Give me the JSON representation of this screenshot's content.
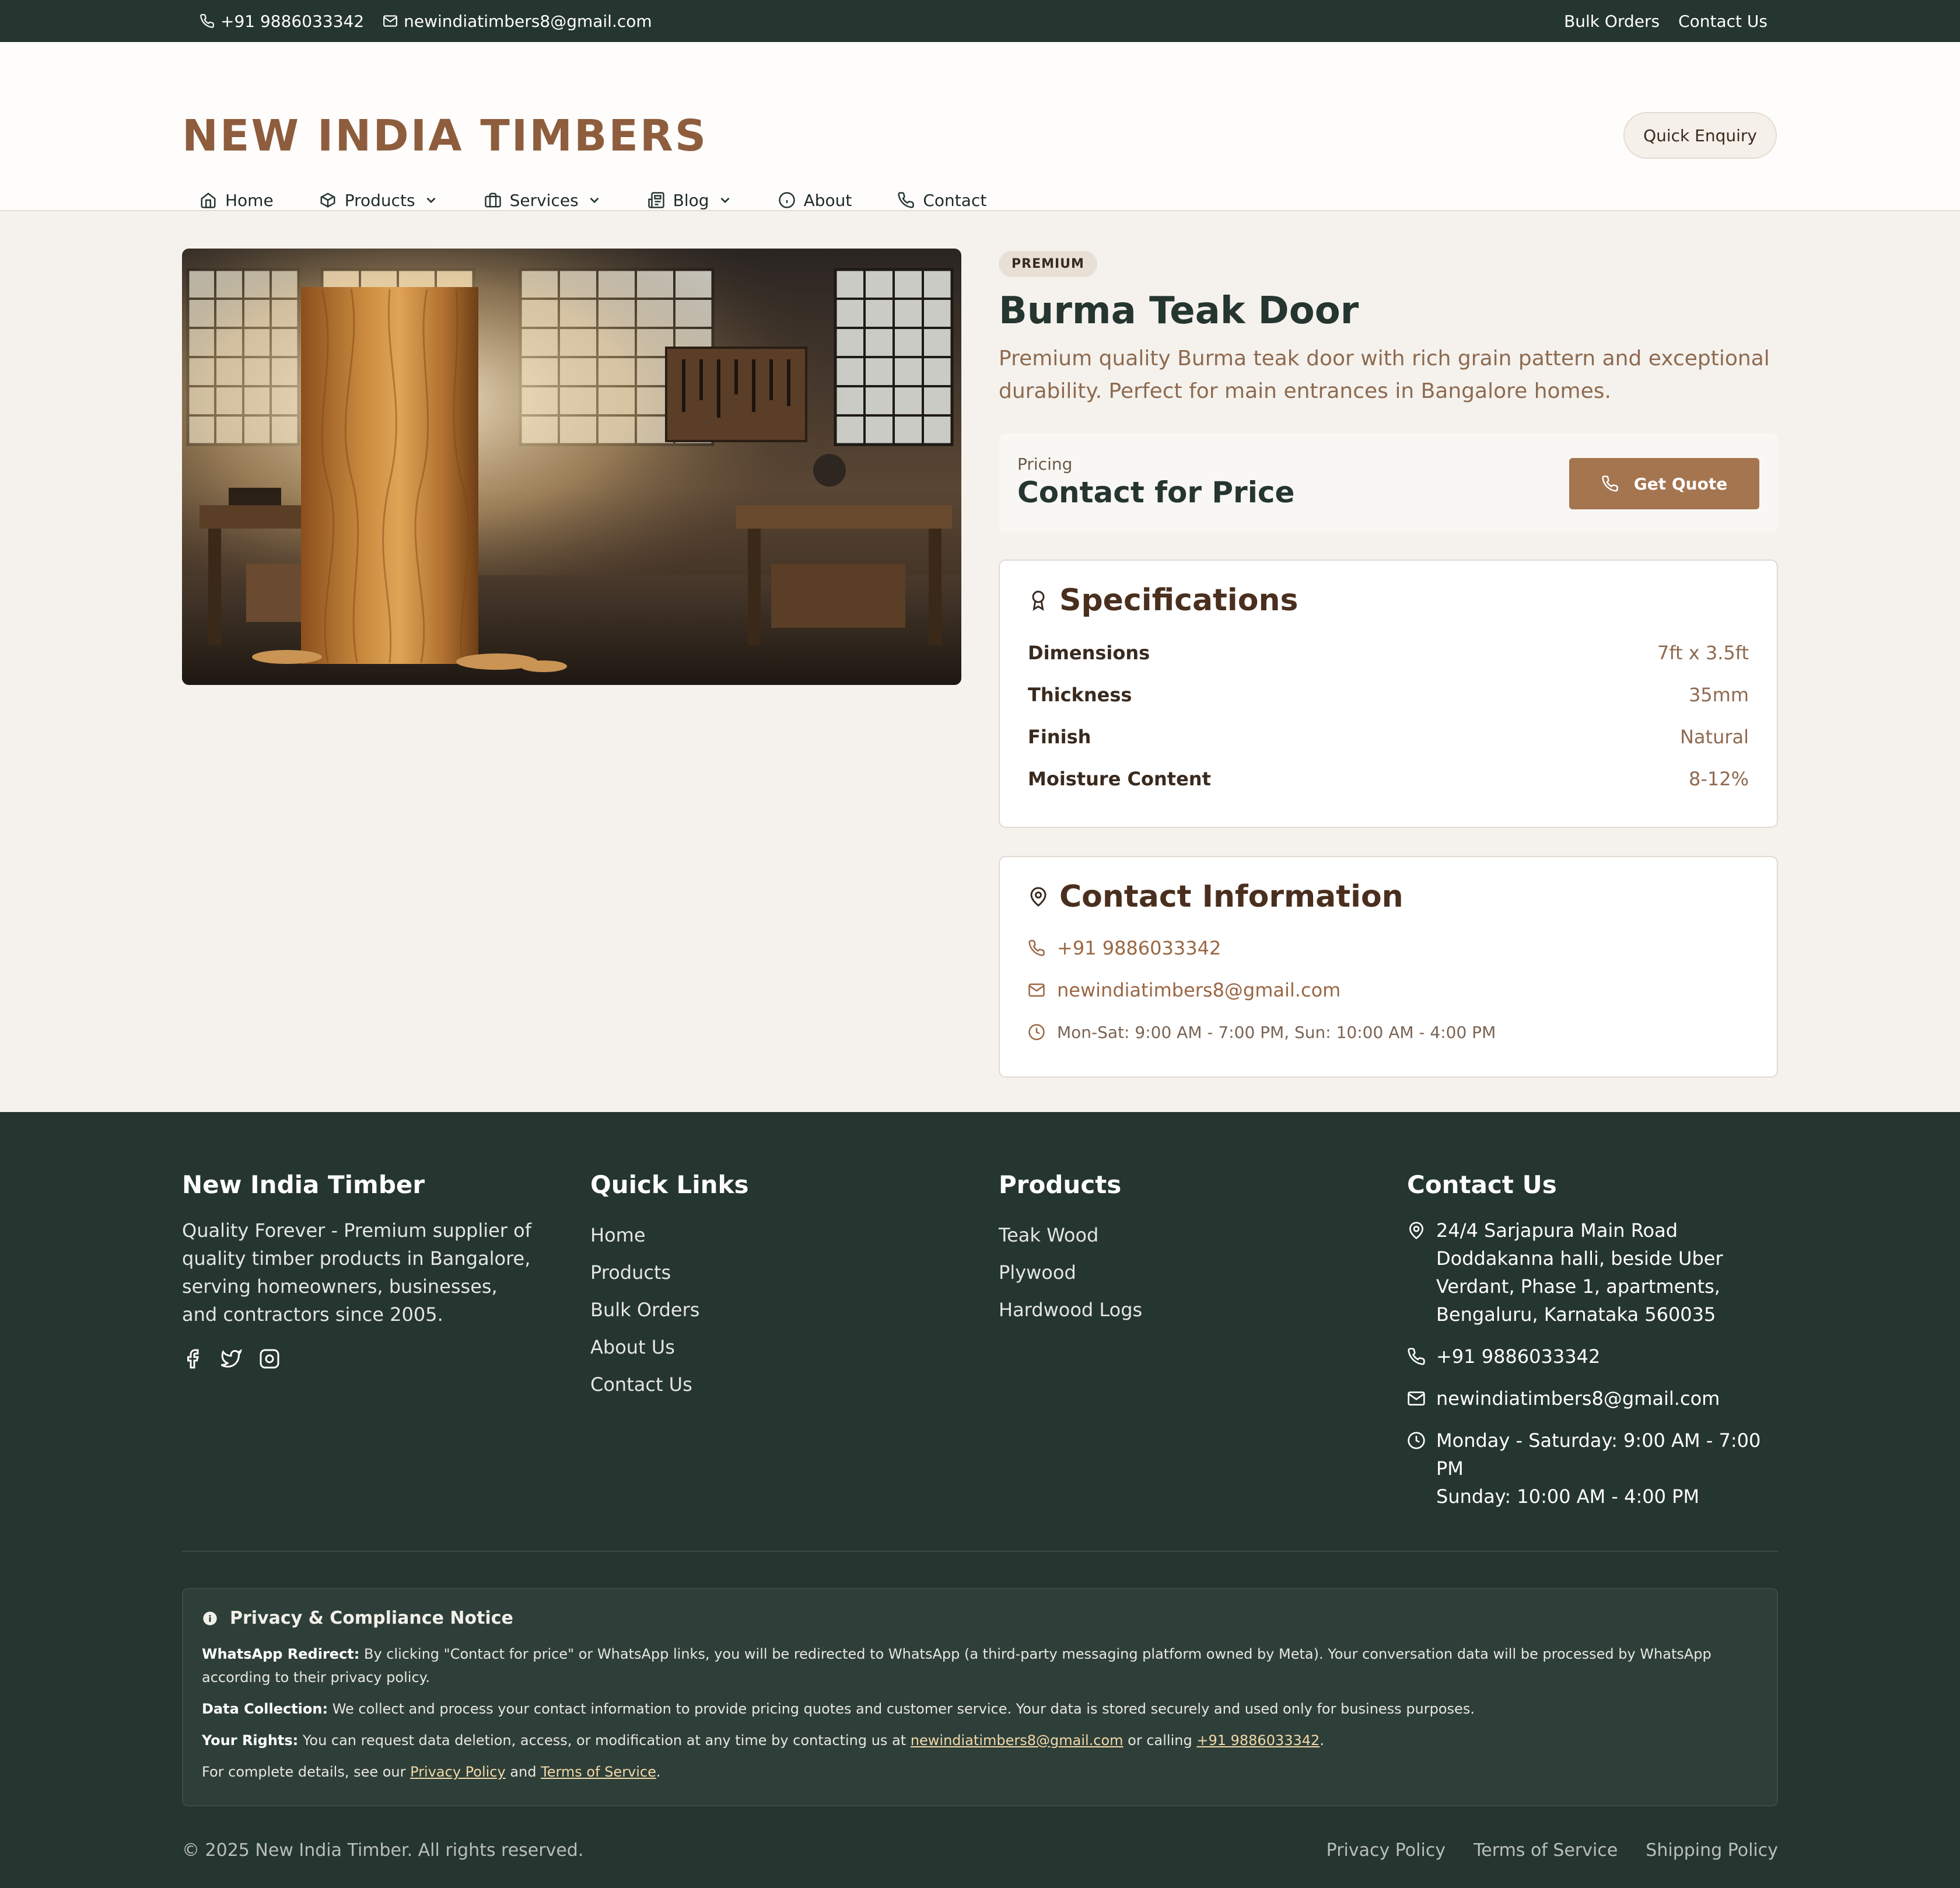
{
  "topbar": {
    "phone": "+91 9886033342",
    "email": "newindiatimbers8@gmail.com",
    "links": [
      "Bulk Orders",
      "Contact Us"
    ]
  },
  "header": {
    "logo": "NEW INDIA TIMBERS",
    "quick_enquiry": "Quick Enquiry",
    "nav": [
      {
        "label": "Home",
        "icon": "home-icon"
      },
      {
        "label": "Products",
        "icon": "box-icon",
        "dropdown": true
      },
      {
        "label": "Services",
        "icon": "briefcase-icon",
        "dropdown": true
      },
      {
        "label": "Blog",
        "icon": "newspaper-icon",
        "dropdown": true
      },
      {
        "label": "About",
        "icon": "info-icon"
      },
      {
        "label": "Contact",
        "icon": "phone-icon"
      }
    ]
  },
  "product": {
    "badge": "PREMIUM",
    "title": "Burma Teak Door",
    "description": "Premium quality Burma teak door with rich grain pattern and exceptional durability. Perfect for main entrances in Bangalore homes.",
    "pricing_label": "Pricing",
    "pricing_value": "Contact for Price",
    "get_quote": "Get Quote"
  },
  "specifications": {
    "title": "Specifications",
    "rows": [
      {
        "key": "Dimensions",
        "value": "7ft x 3.5ft"
      },
      {
        "key": "Thickness",
        "value": "35mm"
      },
      {
        "key": "Finish",
        "value": "Natural"
      },
      {
        "key": "Moisture Content",
        "value": "8-12%"
      }
    ]
  },
  "contact_info": {
    "title": "Contact Information",
    "phone": "+91 9886033342",
    "email": "newindiatimbers8@gmail.com",
    "hours": "Mon-Sat: 9:00 AM - 7:00 PM, Sun: 10:00 AM - 4:00 PM"
  },
  "footer": {
    "about": {
      "title": "New India Timber",
      "text": "Quality Forever - Premium supplier of quality timber products in Bangalore, serving homeowners, businesses, and contractors since 2005."
    },
    "quick_links": {
      "title": "Quick Links",
      "items": [
        "Home",
        "Products",
        "Bulk Orders",
        "About Us",
        "Contact Us"
      ]
    },
    "products": {
      "title": "Products",
      "items": [
        "Teak Wood",
        "Plywood",
        "Hardwood Logs"
      ]
    },
    "contact": {
      "title": "Contact Us",
      "address": "24/4 Sarjapura Main Road Doddakanna halli, beside Uber Verdant, Phase 1, apartments, Bengaluru, Karnataka 560035",
      "phone": "+91 9886033342",
      "email": "newindiatimbers8@gmail.com",
      "hours_weekday": "Monday - Saturday: 9:00 AM - 7:00 PM",
      "hours_sunday": "Sunday: 10:00 AM - 4:00 PM"
    },
    "notice": {
      "title": "Privacy & Compliance Notice",
      "whatsapp_label": "WhatsApp Redirect:",
      "whatsapp_text": " By clicking \"Contact for price\" or WhatsApp links, you will be redirected to WhatsApp (a third-party messaging platform owned by Meta). Your conversation data will be processed by WhatsApp according to their privacy policy.",
      "data_label": "Data Collection:",
      "data_text": " We collect and process your contact information to provide pricing quotes and customer service. Your data is stored securely and used only for business purposes.",
      "rights_label": "Your Rights:",
      "rights_text": " You can request data deletion, access, or modification at any time by contacting us at ",
      "rights_email": "newindiatimbers8@gmail.com",
      "rights_mid": " or calling ",
      "rights_phone": "+91 9886033342",
      "rights_end": ".",
      "details_text": "For complete details, see our ",
      "privacy_link": "Privacy Policy",
      "and_text": " and ",
      "terms_link": "Terms of Service",
      "details_end": "."
    },
    "copyright": "© 2025 New India Timber. All rights reserved.",
    "legal": [
      "Privacy Policy",
      "Terms of Service",
      "Shipping Policy"
    ]
  },
  "colors": {
    "dark_green": "#253530",
    "brand_brown": "#8e5d3d",
    "accent": "#a57550",
    "background": "#f5f2ed"
  }
}
